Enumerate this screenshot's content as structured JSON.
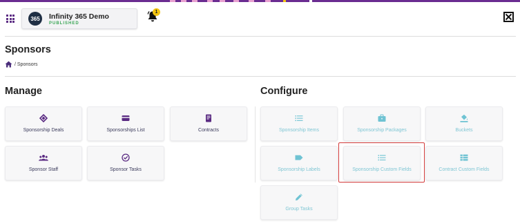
{
  "colors": {
    "brand": "#6a2c91",
    "manage_icon": "#5a2a82",
    "configure_icon": "#6fc3d3",
    "published": "#3aa655",
    "badge": "#f3c511",
    "highlight": "#d23a3a"
  },
  "header": {
    "apps_icon": "grid-icon",
    "org": {
      "logo_text": "365",
      "name": "Infinity 365 Demo",
      "status": "PUBLISHED"
    },
    "notifications": {
      "icon": "bell-icon",
      "count": "1"
    },
    "close_icon": "close-icon"
  },
  "page": {
    "title": "Sponsors",
    "breadcrumb": {
      "home_icon": "home-icon",
      "trail": "/ Sponsors"
    }
  },
  "manage": {
    "title": "Manage",
    "tiles": [
      {
        "label": "Sponsorship Deals",
        "icon": "handshake-icon"
      },
      {
        "label": "Sponsorships List",
        "icon": "card-icon"
      },
      {
        "label": "Contracts",
        "icon": "contract-icon"
      },
      {
        "label": "Sponsor Staff",
        "icon": "people-icon"
      },
      {
        "label": "Sponsor Tasks",
        "icon": "check-circle-icon"
      }
    ]
  },
  "configure": {
    "title": "Configure",
    "tiles": [
      {
        "label": "Sponsorship Items",
        "icon": "list-icon"
      },
      {
        "label": "Sponsorship Packages",
        "icon": "briefcase-icon"
      },
      {
        "label": "Buckets",
        "icon": "paint-bucket-icon"
      },
      {
        "label": "Sponsorship Labels",
        "icon": "tag-icon"
      },
      {
        "label": "Sponsorship Custom Fields",
        "icon": "list-icon",
        "highlighted": true
      },
      {
        "label": "Contract Custom Fields",
        "icon": "table-icon"
      },
      {
        "label": "Group Tasks",
        "icon": "pencil-icon"
      }
    ]
  }
}
